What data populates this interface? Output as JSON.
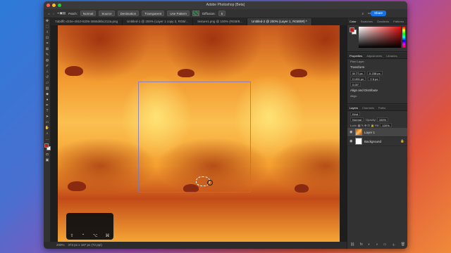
{
  "window": {
    "title": "Adobe Photoshop (Beta)"
  },
  "options": {
    "patch_label": "Patch:",
    "patch_mode": "Normal",
    "source": "Source",
    "destination": "Destination",
    "transparent": "Transparent",
    "use_pattern": "Use Pattern",
    "diffusion_label": "Diffusion:",
    "diffusion_value": "5",
    "share": "Share"
  },
  "tabs": [
    {
      "label": "7abdffc-dc0e-4910-8205-3655d6bc212a.png"
    },
    {
      "label": "Untitled-1 @ 200% (Layer 1 copy 3, RGB/..."
    },
    {
      "label": "texture1.png @ 100% (RGB/8..."
    },
    {
      "label": "Untitled-2 @ 200% (Layer 1, RGB/8#) *"
    }
  ],
  "status": {
    "zoom": "200%",
    "doc": "373 px x 187 px (72 ppi)"
  },
  "colors": {
    "foreground": "#c21a12",
    "background": "#ffffff",
    "accent": "#1473e6"
  },
  "color_panel": {
    "tabs": [
      "Color",
      "Swatches",
      "Gradients",
      "Patterns"
    ]
  },
  "properties": {
    "tabs": [
      "Properties",
      "Adjustments",
      "Libraries"
    ],
    "layer_type": "Pixel Layer",
    "transform_title": "Transform",
    "w": "W 77 px",
    "x": "X 238 px",
    "h": "H 491 px",
    "y": "Y 6 px",
    "angle": "0.00°",
    "align_title": "Align and Distribute",
    "align_label": "Align:"
  },
  "layers": {
    "tabs": [
      "Layers",
      "Channels",
      "Paths"
    ],
    "kind": "Kind",
    "blend": "Normal",
    "opacity_label": "Opacity:",
    "opacity": "100%",
    "lock_label": "Lock:",
    "fill_label": "Fill:",
    "fill": "100%",
    "items": [
      {
        "name": "Layer 1",
        "selected": true
      },
      {
        "name": "Background",
        "selected": false
      }
    ]
  }
}
